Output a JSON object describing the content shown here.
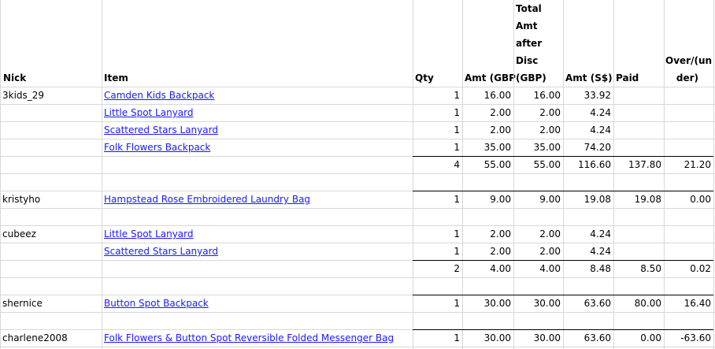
{
  "headers": {
    "nick": "Nick",
    "item": "Item",
    "qty": "Qty",
    "amt_gbp": "Amt (GBP",
    "total_line1": "Total",
    "total_line2": "Amt",
    "total_line3": "after",
    "total_line4": "Disc",
    "total_line5": "(GBP)",
    "amt_sgd": "Amt (S$)",
    "paid": "Paid",
    "over_line1": "Over/(un",
    "over_line2": "der)"
  },
  "rows": [
    {
      "nick": "3kids_29",
      "item": "Camden Kids Backpack",
      "qty": "1",
      "amt_gbp": "16.00",
      "total": "16.00",
      "amt_sgd": "33.92",
      "paid": "",
      "over": ""
    },
    {
      "nick": "",
      "item": "Little Spot Lanyard",
      "qty": "1",
      "amt_gbp": "2.00",
      "total": "2.00",
      "amt_sgd": "4.24",
      "paid": "",
      "over": ""
    },
    {
      "nick": "",
      "item": "Scattered Stars Lanyard",
      "qty": "1",
      "amt_gbp": "2.00",
      "total": "2.00",
      "amt_sgd": "4.24",
      "paid": "",
      "over": ""
    },
    {
      "nick": "",
      "item": "Folk Flowers Backpack",
      "qty": "1",
      "amt_gbp": "35.00",
      "total": "35.00",
      "amt_sgd": "74.20",
      "paid": "",
      "over": ""
    },
    {
      "nick": "",
      "item": "",
      "qty": "4",
      "amt_gbp": "55.00",
      "total": "55.00",
      "amt_sgd": "116.60",
      "paid": "137.80",
      "over": "21.20"
    },
    {
      "nick": "",
      "item": "",
      "qty": "",
      "amt_gbp": "",
      "total": "",
      "amt_sgd": "",
      "paid": "",
      "over": ""
    },
    {
      "nick": "kristyho",
      "item": "Hampstead Rose Embroidered Laundry Bag",
      "qty": "1",
      "amt_gbp": "9.00",
      "total": "9.00",
      "amt_sgd": "19.08",
      "paid": "19.08",
      "over": "0.00"
    },
    {
      "nick": "",
      "item": "",
      "qty": "",
      "amt_gbp": "",
      "total": "",
      "amt_sgd": "",
      "paid": "",
      "over": ""
    },
    {
      "nick": "cubeez",
      "item": "Little Spot Lanyard",
      "qty": "1",
      "amt_gbp": "2.00",
      "total": "2.00",
      "amt_sgd": "4.24",
      "paid": "",
      "over": ""
    },
    {
      "nick": "",
      "item": "Scattered Stars Lanyard",
      "qty": "1",
      "amt_gbp": "2.00",
      "total": "2.00",
      "amt_sgd": "4.24",
      "paid": "",
      "over": ""
    },
    {
      "nick": "",
      "item": "",
      "qty": "2",
      "amt_gbp": "4.00",
      "total": "4.00",
      "amt_sgd": "8.48",
      "paid": "8.50",
      "over": "0.02"
    },
    {
      "nick": "",
      "item": "",
      "qty": "",
      "amt_gbp": "",
      "total": "",
      "amt_sgd": "",
      "paid": "",
      "over": ""
    },
    {
      "nick": "shernice",
      "item": "Button Spot Backpack",
      "qty": "1",
      "amt_gbp": "30.00",
      "total": "30.00",
      "amt_sgd": "63.60",
      "paid": "80.00",
      "over": "16.40"
    },
    {
      "nick": "",
      "item": "",
      "qty": "",
      "amt_gbp": "",
      "total": "",
      "amt_sgd": "",
      "paid": "",
      "over": ""
    },
    {
      "nick": "charlene2008",
      "item": "Folk Flowers & Button Spot Reversible Folded Messenger Bag",
      "qty": "1",
      "amt_gbp": "30.00",
      "total": "30.00",
      "amt_sgd": "63.60",
      "paid": "0.00",
      "over": "-63.60"
    },
    {
      "nick": "",
      "item": "",
      "qty": "",
      "amt_gbp": "",
      "total": "",
      "amt_sgd": "",
      "paid": "",
      "over": ""
    }
  ]
}
